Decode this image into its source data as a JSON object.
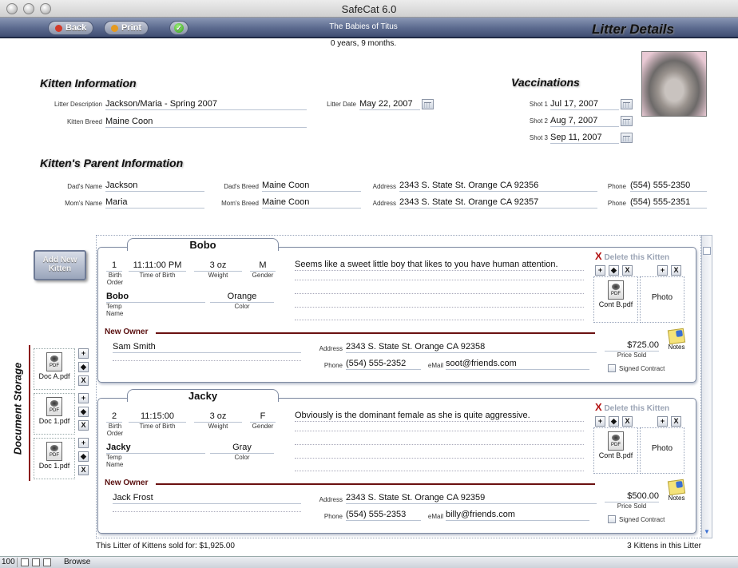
{
  "window": {
    "title": "SafeCat 6.0"
  },
  "toolbar": {
    "back_label": "Back",
    "print_label": "Print",
    "ok_glyph": "✓",
    "litter_name": "The Babies of Titus",
    "page_title": "Litter Details"
  },
  "litter_age": "0 years, 9 months.",
  "kitten_info": {
    "heading": "Kitten Information",
    "desc_label": "Litter Description",
    "desc_value": "Jackson/Maria - Spring 2007",
    "breed_label": "Kitten Breed",
    "breed_value": "Maine Coon",
    "date_label": "Litter Date",
    "date_value": "May 22, 2007"
  },
  "vaccinations": {
    "heading": "Vaccinations",
    "shots": [
      {
        "label": "Shot 1",
        "value": "Jul 17, 2007"
      },
      {
        "label": "Shot 2",
        "value": "Aug 7, 2007"
      },
      {
        "label": "Shot 3",
        "value": "Sep 11, 2007"
      }
    ]
  },
  "parents": {
    "heading": "Kitten's Parent Information",
    "dad": {
      "name_label": "Dad's Name",
      "name": "Jackson",
      "breed_label": "Dad's Breed",
      "breed": "Maine Coon",
      "address_label": "Address",
      "address": "2343 S. State St. Orange CA 92356",
      "phone_label": "Phone",
      "phone": "(554) 555-2350"
    },
    "mom": {
      "name_label": "Mom's Name",
      "name": "Maria",
      "breed_label": "Mom's Breed",
      "breed": "Maine Coon",
      "address_label": "Address",
      "address": "2343 S. State St. Orange CA 92357",
      "phone_label": "Phone",
      "phone": "(554) 555-2351"
    }
  },
  "add_kitten_label": "Add New Kitten",
  "document_storage": {
    "label": "Document Storage",
    "docs": [
      {
        "name": "Doc A.pdf",
        "type": "PDF"
      },
      {
        "name": "Doc 1.pdf",
        "type": "PDF"
      },
      {
        "name": "Doc 1.pdf",
        "type": "PDF"
      }
    ],
    "btn_add": "+",
    "btn_diamond": "◆",
    "btn_remove": "X"
  },
  "kitten_labels": {
    "birth_order": "Birth Order",
    "time_of_birth": "Time of Birth",
    "weight": "Weight",
    "gender": "Gender",
    "temp_name": "Temp Name",
    "color": "Color",
    "new_owner": "New Owner",
    "address": "Address",
    "phone": "Phone",
    "email": "eMail",
    "price_sold": "Price Sold",
    "notes": "Notes",
    "signed_contract": "Signed Contract",
    "delete": "Delete this Kitten",
    "delete_glyph": "X",
    "photo": "Photo"
  },
  "kittens": [
    {
      "name": "Bobo",
      "birth_order": "1",
      "time_of_birth": "11:11:00 PM",
      "weight": "3 oz",
      "gender": "M",
      "temp_name": "Bobo",
      "color": "Orange",
      "note": "Seems like a sweet little boy that likes to you have human attention.",
      "owner_name": "Sam Smith",
      "owner_address": "2343 S. State St. Orange CA 92358",
      "owner_phone": "(554) 555-2352",
      "owner_email": "soot@friends.com",
      "price": "$725.00",
      "contract_doc": "Cont B.pdf",
      "contract_type": "PDF"
    },
    {
      "name": "Jacky",
      "birth_order": "2",
      "time_of_birth": "11:15:00",
      "weight": "3 oz",
      "gender": "F",
      "temp_name": "Jacky",
      "color": "Gray",
      "note": "Obviously is the dominant female as she is quite aggressive.",
      "owner_name": "Jack Frost",
      "owner_address": "2343 S. State St. Orange CA 92359",
      "owner_phone": "(554) 555-2353",
      "owner_email": "billy@friends.com",
      "price": "$500.00",
      "contract_doc": "Cont B.pdf",
      "contract_type": "PDF"
    }
  ],
  "footer": {
    "sold_text": "This Litter of Kittens sold for: $1,925.00",
    "count_text": "3 Kittens in this Litter"
  },
  "statusbar": {
    "zoom": "100",
    "mode": "Browse"
  }
}
